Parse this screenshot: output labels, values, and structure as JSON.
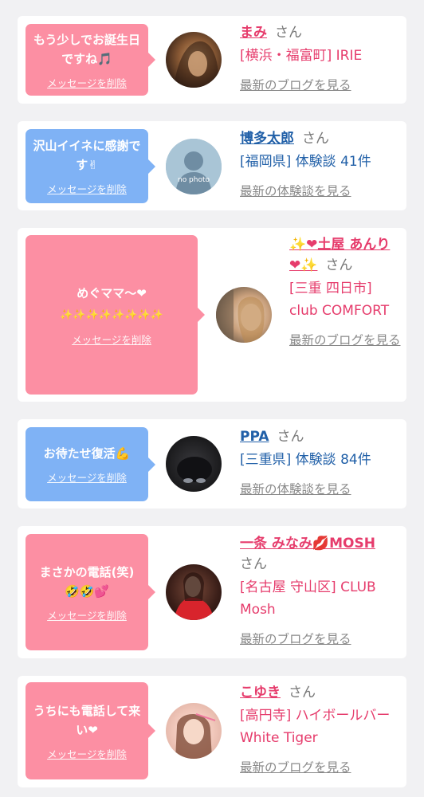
{
  "entries": [
    {
      "message": "もう少しでお誕生日ですね🎵",
      "delete_label": "メッセージを削除",
      "name": "まみ",
      "honorific": "さん",
      "shop": "[横浜・福富町] IRIE",
      "link": "最新のブログを見る"
    },
    {
      "message": "沢山イイネに感謝です✌",
      "delete_label": "メッセージを削除",
      "name": "博多太郎",
      "honorific": "さん",
      "shop": "[福岡県] 体験談 41件",
      "link": "最新の体験談を見る",
      "avatar_text": "no photo"
    },
    {
      "message": "めぐママ〜❤",
      "message2": "✨✨✨✨✨✨✨✨",
      "delete_label": "メッセージを削除",
      "name": "✨❤土屋 あんり❤✨",
      "honorific": "さん",
      "shop": "[三重 四日市] club COMFORT",
      "link": "最新のブログを見る"
    },
    {
      "message": "お待たせ復活💪",
      "delete_label": "メッセージを削除",
      "name": "PPA",
      "honorific": "さん",
      "shop": "[三重県] 体験談 84件",
      "link": "最新の体験談を見る"
    },
    {
      "message": "まさかの電話(笑)🤣🤣💕",
      "delete_label": "メッセージを削除",
      "name": "一条 みなみ💋MOSH",
      "honorific": "さん",
      "shop": "[名古屋 守山区] CLUB Mosh",
      "link": "最新のブログを見る"
    },
    {
      "message": "うちにも電話して来い❤",
      "delete_label": "メッセージを削除",
      "name": "こゆき",
      "honorific": "さん",
      "shop": "[高円寺] ハイボールバー White Tiger",
      "link": "最新のブログを見る"
    }
  ],
  "colors": {
    "pink": "#fc8fa3",
    "blue": "#7fb2f5",
    "name_pink": "#e63c6c",
    "name_blue": "#2160a8"
  }
}
